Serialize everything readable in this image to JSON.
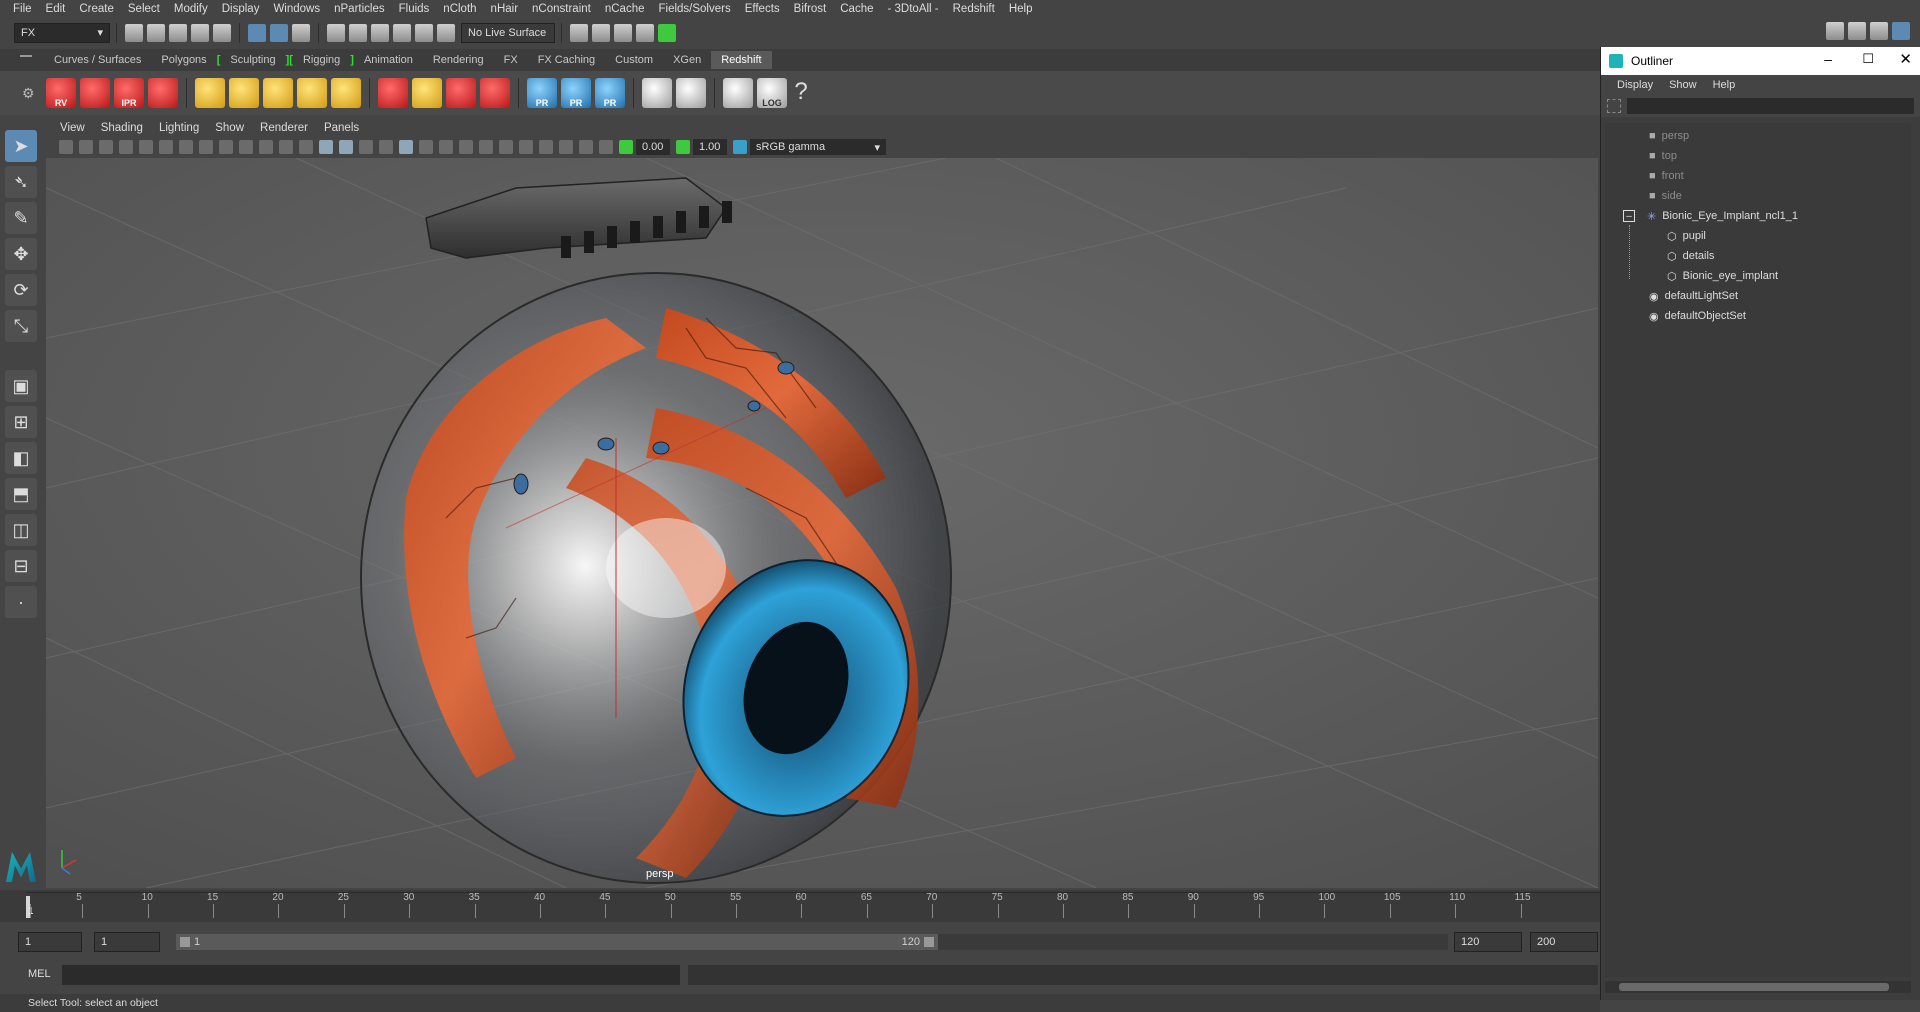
{
  "menubar": {
    "items": [
      "File",
      "Edit",
      "Create",
      "Select",
      "Modify",
      "Display",
      "Windows",
      "nParticles",
      "Fluids",
      "nCloth",
      "nHair",
      "nConstraint",
      "nCache",
      "Fields/Solvers",
      "Effects",
      "Bifrost",
      "Cache",
      "- 3DtoAll -",
      "Redshift",
      "Help"
    ]
  },
  "statusline": {
    "menuset": "FX",
    "live_surface": "No Live Surface"
  },
  "shelf": {
    "tabs": [
      "Curves / Surfaces",
      "Polygons",
      "Sculpting",
      "Rigging",
      "Animation",
      "Rendering",
      "FX",
      "FX Caching",
      "Custom",
      "XGen",
      "Redshift"
    ],
    "active_tab": "Redshift",
    "button_labels": [
      "RV",
      "",
      "IPR",
      ""
    ],
    "pr_labels": [
      "PR",
      "PR",
      "PR"
    ],
    "log_label": "LOG",
    "help_glyph": "?"
  },
  "panel": {
    "menus": [
      "View",
      "Shading",
      "Lighting",
      "Show",
      "Renderer",
      "Panels"
    ],
    "exposure": "0.00",
    "gamma": "1.00",
    "colorspace": "sRGB gamma",
    "camera_label": "persp"
  },
  "timeline": {
    "ticks": [
      "1",
      "5",
      "10",
      "15",
      "20",
      "25",
      "30",
      "35",
      "40",
      "45",
      "50",
      "55",
      "60",
      "65",
      "70",
      "75",
      "80",
      "85",
      "90",
      "95",
      "100",
      "105",
      "110",
      "115"
    ],
    "current_frame": "1"
  },
  "range": {
    "start": "1",
    "anim_start": "1",
    "slider_start": "1",
    "slider_end": "120",
    "end": "120",
    "anim_end": "200"
  },
  "cmdline": {
    "label": "MEL"
  },
  "helpline": {
    "text": "Select Tool: select an object"
  },
  "outliner": {
    "title": "Outliner",
    "menus": [
      "Display",
      "Show",
      "Help"
    ],
    "items": [
      {
        "label": "persp",
        "type": "camera",
        "dim": true
      },
      {
        "label": "top",
        "type": "camera",
        "dim": true
      },
      {
        "label": "front",
        "type": "camera",
        "dim": true
      },
      {
        "label": "side",
        "type": "camera",
        "dim": true
      },
      {
        "label": "Bionic_Eye_Implant_ncl1_1",
        "type": "group"
      },
      {
        "label": "pupil",
        "type": "mesh"
      },
      {
        "label": "details",
        "type": "mesh"
      },
      {
        "label": "Bionic_eye_implant",
        "type": "mesh"
      },
      {
        "label": "defaultLightSet",
        "type": "set"
      },
      {
        "label": "defaultObjectSet",
        "type": "set"
      }
    ]
  },
  "colors": {
    "accent": "#5d8ab3",
    "implant_orange": "#e0521e",
    "iris_blue": "#2a8fc4",
    "maya_teal": "#1fb3b8"
  }
}
